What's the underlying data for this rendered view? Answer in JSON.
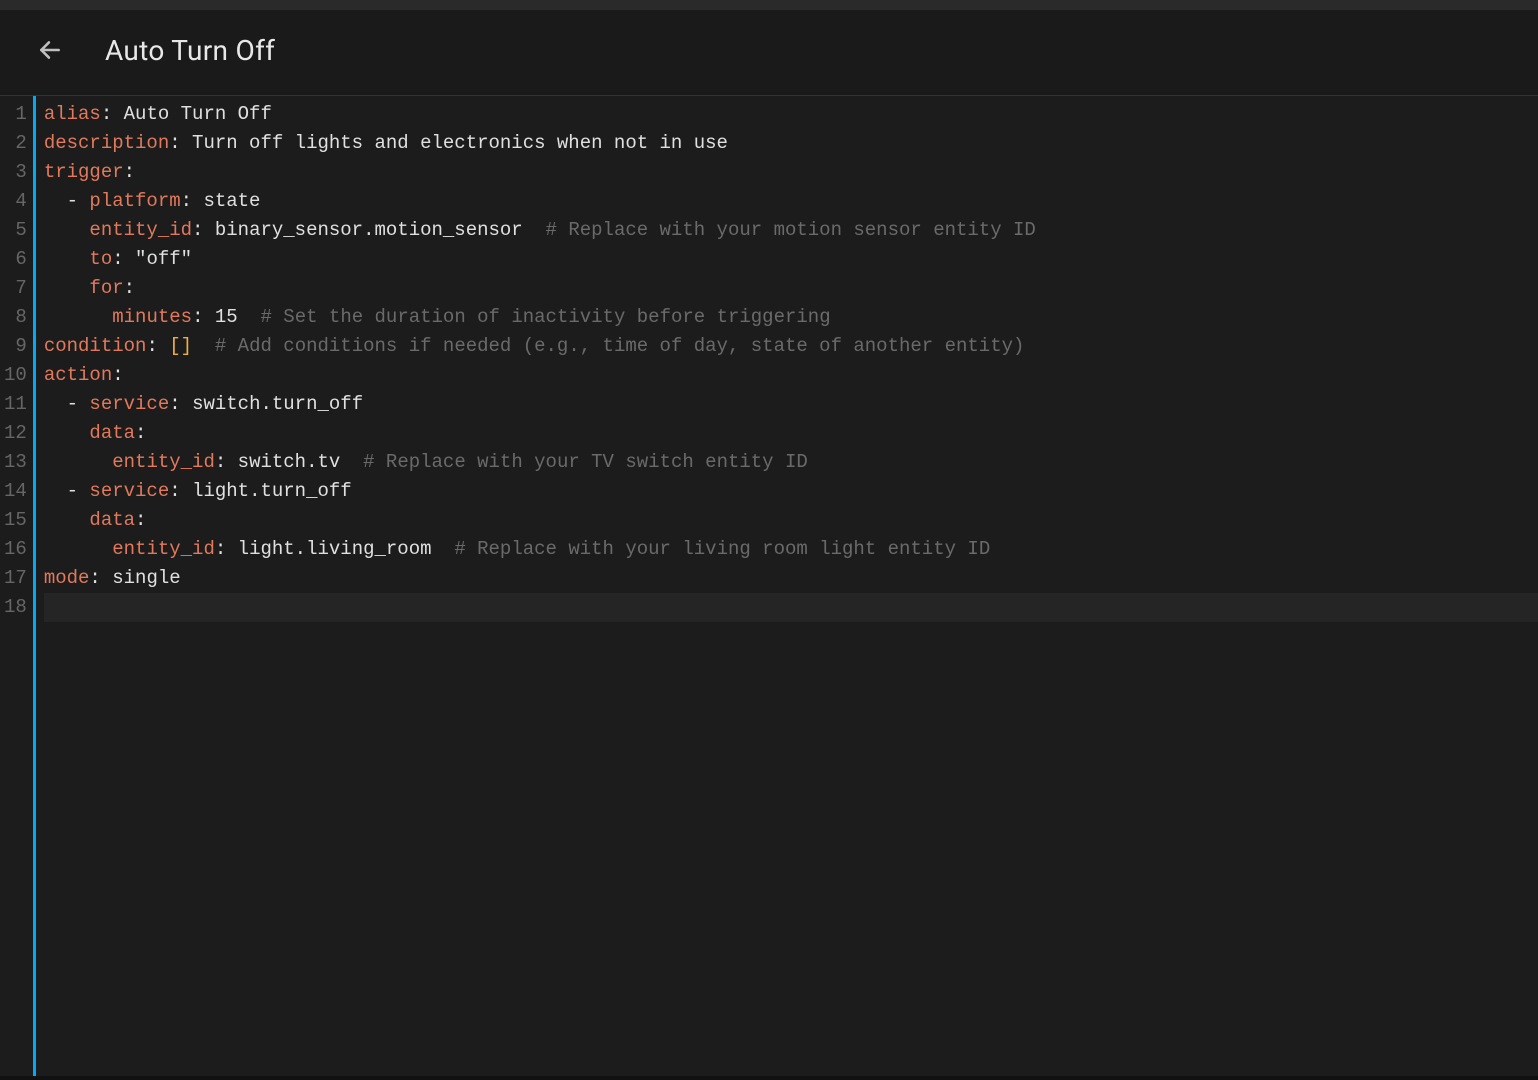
{
  "header": {
    "title": "Auto Turn Off"
  },
  "editor": {
    "line_count": 18,
    "active_line": 18,
    "lines": [
      {
        "n": 1,
        "segs": [
          {
            "t": "alias",
            "c": "key"
          },
          {
            "t": ": ",
            "c": "punc"
          },
          {
            "t": "Auto Turn Off",
            "c": "val"
          }
        ]
      },
      {
        "n": 2,
        "segs": [
          {
            "t": "description",
            "c": "key"
          },
          {
            "t": ": ",
            "c": "punc"
          },
          {
            "t": "Turn off lights and electronics when not in use",
            "c": "val"
          }
        ]
      },
      {
        "n": 3,
        "segs": [
          {
            "t": "trigger",
            "c": "key"
          },
          {
            "t": ":",
            "c": "punc"
          }
        ]
      },
      {
        "n": 4,
        "segs": [
          {
            "t": "  - ",
            "c": "punc"
          },
          {
            "t": "platform",
            "c": "key"
          },
          {
            "t": ": ",
            "c": "punc"
          },
          {
            "t": "state",
            "c": "val"
          }
        ]
      },
      {
        "n": 5,
        "segs": [
          {
            "t": "    ",
            "c": "punc"
          },
          {
            "t": "entity_id",
            "c": "key"
          },
          {
            "t": ": ",
            "c": "punc"
          },
          {
            "t": "binary_sensor.motion_sensor",
            "c": "val"
          },
          {
            "t": "  ",
            "c": "punc"
          },
          {
            "t": "# Replace with your motion sensor entity ID",
            "c": "comment"
          }
        ]
      },
      {
        "n": 6,
        "segs": [
          {
            "t": "    ",
            "c": "punc"
          },
          {
            "t": "to",
            "c": "key"
          },
          {
            "t": ": ",
            "c": "punc"
          },
          {
            "t": "\"off\"",
            "c": "str"
          }
        ]
      },
      {
        "n": 7,
        "segs": [
          {
            "t": "    ",
            "c": "punc"
          },
          {
            "t": "for",
            "c": "key"
          },
          {
            "t": ":",
            "c": "punc"
          }
        ]
      },
      {
        "n": 8,
        "segs": [
          {
            "t": "      ",
            "c": "punc"
          },
          {
            "t": "minutes",
            "c": "key"
          },
          {
            "t": ": ",
            "c": "punc"
          },
          {
            "t": "15",
            "c": "num"
          },
          {
            "t": "  ",
            "c": "punc"
          },
          {
            "t": "# Set the duration of inactivity before triggering",
            "c": "comment"
          }
        ]
      },
      {
        "n": 9,
        "segs": [
          {
            "t": "condition",
            "c": "key"
          },
          {
            "t": ": ",
            "c": "punc"
          },
          {
            "t": "[]",
            "c": "brkt"
          },
          {
            "t": "  ",
            "c": "punc"
          },
          {
            "t": "# Add conditions if needed (e.g., time of day, state of another entity)",
            "c": "comment"
          }
        ]
      },
      {
        "n": 10,
        "segs": [
          {
            "t": "action",
            "c": "key"
          },
          {
            "t": ":",
            "c": "punc"
          }
        ]
      },
      {
        "n": 11,
        "segs": [
          {
            "t": "  - ",
            "c": "punc"
          },
          {
            "t": "service",
            "c": "key"
          },
          {
            "t": ": ",
            "c": "punc"
          },
          {
            "t": "switch.turn_off",
            "c": "val"
          }
        ]
      },
      {
        "n": 12,
        "segs": [
          {
            "t": "    ",
            "c": "punc"
          },
          {
            "t": "data",
            "c": "key"
          },
          {
            "t": ":",
            "c": "punc"
          }
        ]
      },
      {
        "n": 13,
        "segs": [
          {
            "t": "      ",
            "c": "punc"
          },
          {
            "t": "entity_id",
            "c": "key"
          },
          {
            "t": ": ",
            "c": "punc"
          },
          {
            "t": "switch.tv",
            "c": "val"
          },
          {
            "t": "  ",
            "c": "punc"
          },
          {
            "t": "# Replace with your TV switch entity ID",
            "c": "comment"
          }
        ]
      },
      {
        "n": 14,
        "segs": [
          {
            "t": "  - ",
            "c": "punc"
          },
          {
            "t": "service",
            "c": "key"
          },
          {
            "t": ": ",
            "c": "punc"
          },
          {
            "t": "light.turn_off",
            "c": "val"
          }
        ]
      },
      {
        "n": 15,
        "segs": [
          {
            "t": "    ",
            "c": "punc"
          },
          {
            "t": "data",
            "c": "key"
          },
          {
            "t": ":",
            "c": "punc"
          }
        ]
      },
      {
        "n": 16,
        "segs": [
          {
            "t": "      ",
            "c": "punc"
          },
          {
            "t": "entity_id",
            "c": "key"
          },
          {
            "t": ": ",
            "c": "punc"
          },
          {
            "t": "light.living_room",
            "c": "val"
          },
          {
            "t": "  ",
            "c": "punc"
          },
          {
            "t": "# Replace with your living room light entity ID",
            "c": "comment"
          }
        ]
      },
      {
        "n": 17,
        "segs": [
          {
            "t": "mode",
            "c": "key"
          },
          {
            "t": ": ",
            "c": "punc"
          },
          {
            "t": "single",
            "c": "val"
          }
        ]
      },
      {
        "n": 18,
        "segs": [
          {
            "t": "",
            "c": "punc"
          }
        ]
      }
    ]
  }
}
